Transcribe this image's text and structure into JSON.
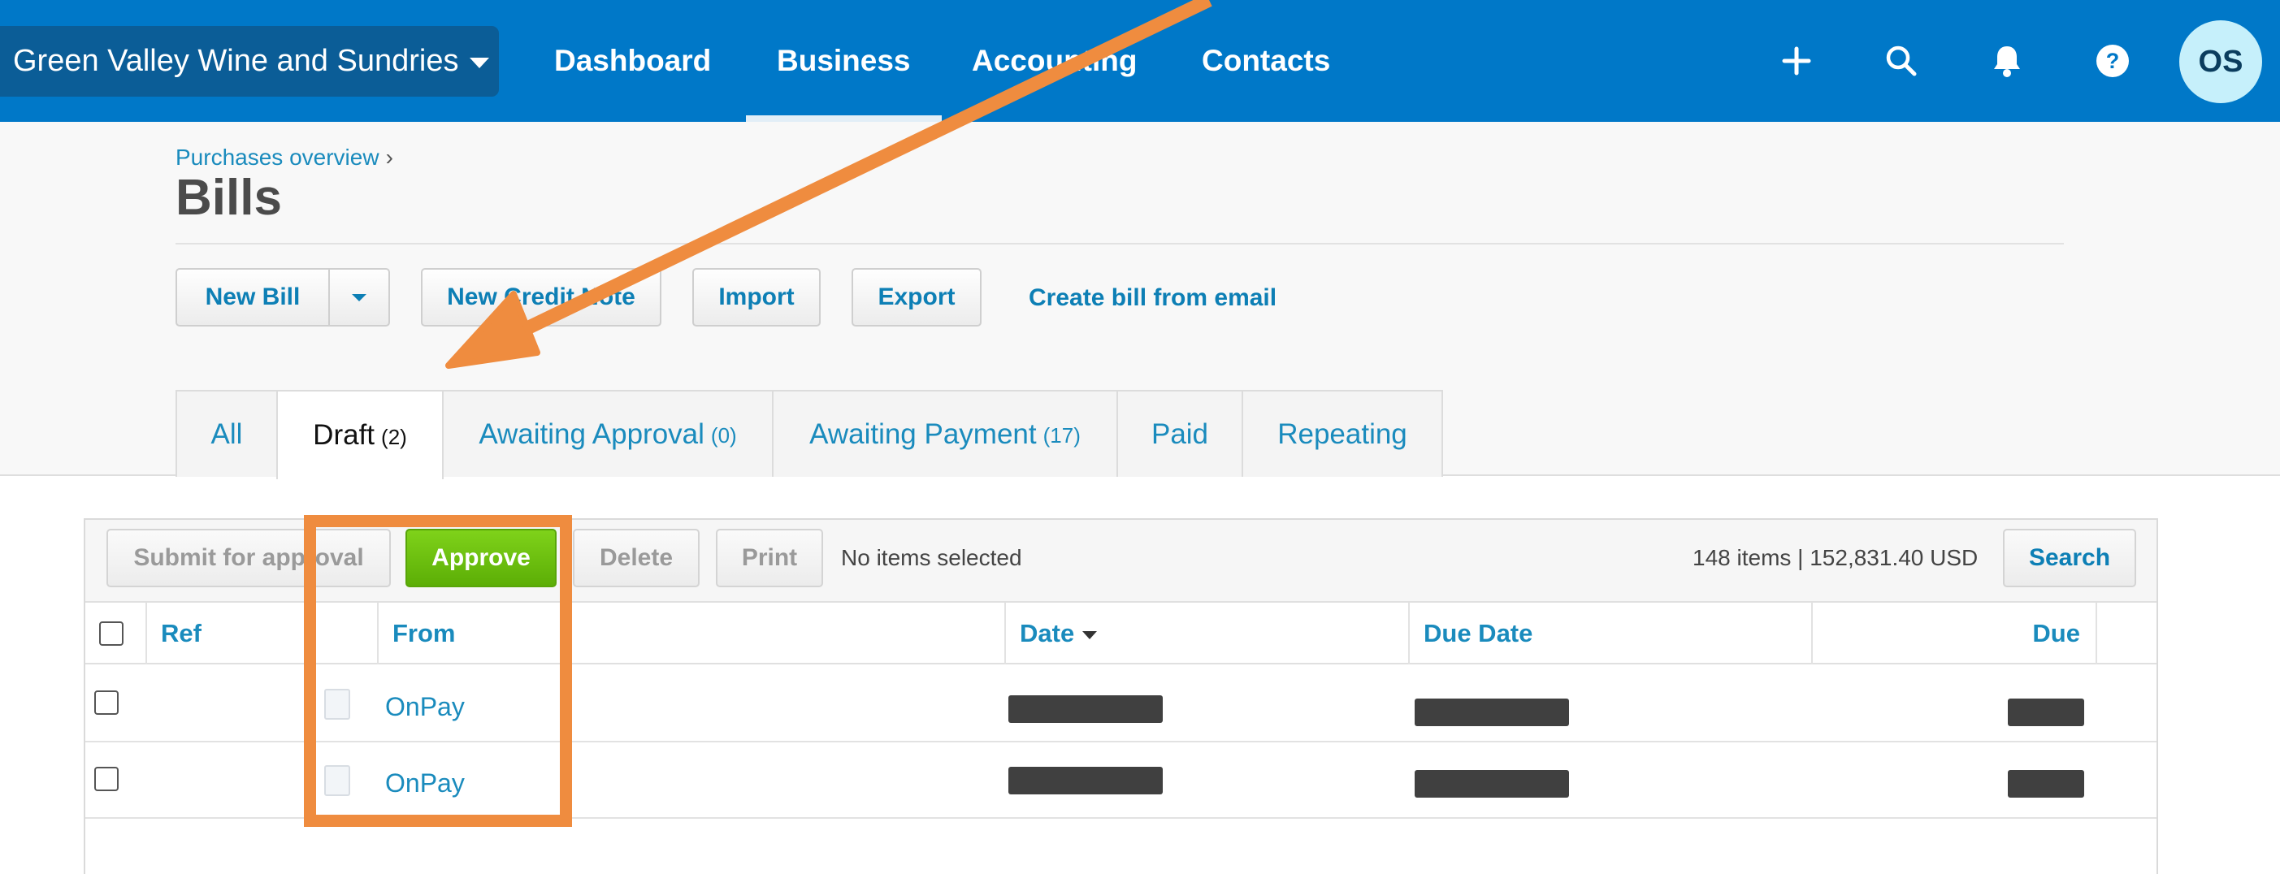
{
  "header": {
    "org_name": "Green Valley Wine and Sundries",
    "nav": [
      "Dashboard",
      "Business",
      "Accounting",
      "Contacts"
    ],
    "active_nav": "Business",
    "icons": [
      "plus-icon",
      "search-icon",
      "bell-icon",
      "help-icon"
    ],
    "avatar_initials": "OS"
  },
  "page": {
    "breadcrumb": "Purchases overview",
    "breadcrumb_sep": "›",
    "title": "Bills"
  },
  "actions": {
    "new_bill": "New Bill",
    "new_credit_note": "New Credit Note",
    "import": "Import",
    "export": "Export",
    "create_from_email": "Create bill from email"
  },
  "tabs": [
    {
      "label": "All",
      "count": ""
    },
    {
      "label": "Draft",
      "count": "(2)",
      "active": true
    },
    {
      "label": "Awaiting Approval",
      "count": "(0)"
    },
    {
      "label": "Awaiting Payment",
      "count": "(17)"
    },
    {
      "label": "Paid",
      "count": ""
    },
    {
      "label": "Repeating",
      "count": ""
    }
  ],
  "toolbar": {
    "submit": "Submit for approval",
    "approve": "Approve",
    "delete": "Delete",
    "print": "Print",
    "selection_status": "No items selected",
    "summary": "148 items | 152,831.40 USD",
    "search": "Search"
  },
  "table": {
    "columns": [
      "Ref",
      "From",
      "Date",
      "Due Date",
      "Due"
    ],
    "rows": [
      {
        "from": "OnPay"
      },
      {
        "from": "OnPay"
      }
    ]
  },
  "colors": {
    "nav_bg": "#0078c8",
    "accent_link": "#1a8bbd",
    "approve_green": "#5cae06",
    "annotation_orange": "#ef8c3f"
  }
}
